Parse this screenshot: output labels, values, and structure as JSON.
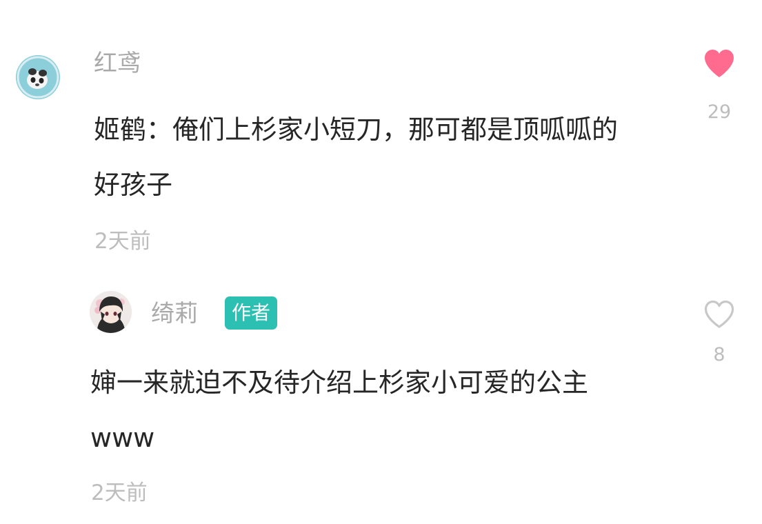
{
  "comments": [
    {
      "username": "红鸢",
      "text": "姬鹤：俺们上杉家小短刀，那可都是顶呱呱的好孩子",
      "time": "2天前",
      "liked": true,
      "like_count": "29",
      "avatar_icon": "panda-avatar-icon"
    },
    {
      "username": "绮莉",
      "badge": "作者",
      "text": "婶一来就迫不及待介绍上杉家小可爱的公主www",
      "time": "2天前",
      "liked": false,
      "like_count": "8",
      "avatar_icon": "anime-character-avatar-icon"
    }
  ],
  "colors": {
    "liked_heart": "#ff6b8e",
    "unliked_heart": "#c8c8c8",
    "author_badge": "#2cc0b3"
  }
}
